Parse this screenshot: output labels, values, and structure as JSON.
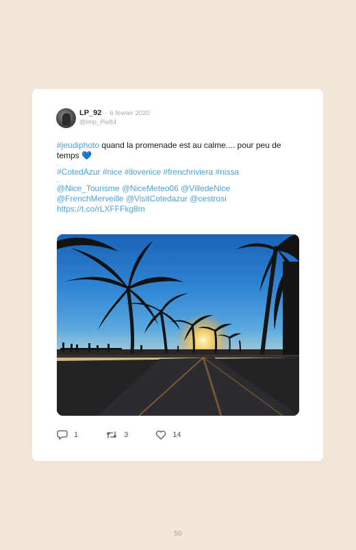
{
  "tweet": {
    "author": "LP_92",
    "separator": "·",
    "date": "6 février 2020",
    "handle": "@lmp_Pix84",
    "hashtag_lead": "#jeudiphoto",
    "text_main": " quand la promenade est au calme.... pour peu de temps ",
    "heart": "💙",
    "dot1": ".",
    "hashtags": "#CotedAzur #nice #ilovenice #frenchriviera #nissa",
    "dot2": ".",
    "mentions_line1": "@Nice_Tourisme @NiceMeteo06 @VilledeNice",
    "mentions_line2": "@FrenchMerveille @VisitCotedazur @cestrosi",
    "url": "https://t.co/rLXFFFkg8m",
    "photo_icon": "palm-promenade-sunset-photo"
  },
  "actions": {
    "replies": "1",
    "retweets": "3",
    "likes": "14"
  },
  "page_number": "50",
  "colors": {
    "background": "#f2e6da",
    "card": "#ffffff",
    "link": "#4aa3df"
  }
}
